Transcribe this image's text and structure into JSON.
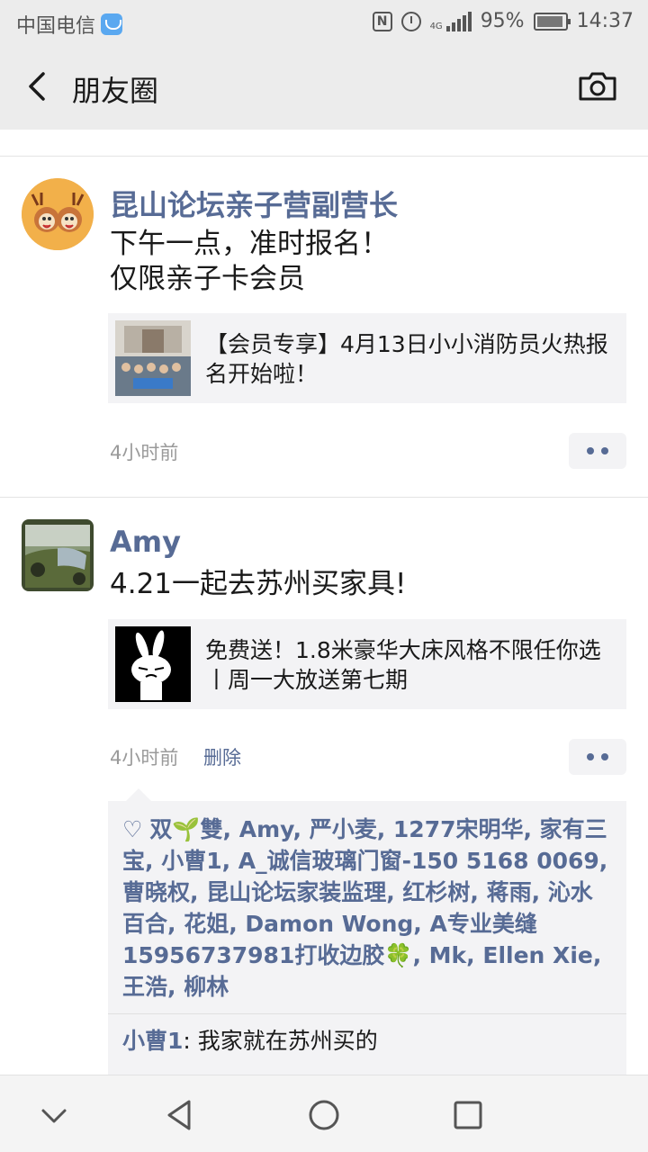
{
  "status_bar": {
    "carrier": "中国电信",
    "battery": "95%",
    "time": "14:37",
    "network": "4G"
  },
  "nav": {
    "title": "朋友圈",
    "back_icon": "chevron-left-icon",
    "camera_icon": "camera-icon"
  },
  "posts": [
    {
      "author": "昆山论坛亲子营副营长",
      "text_line1": "下午一点，准时报名！",
      "text_line2": "仅限亲子卡会员",
      "link_title": "【会员专享】4月13日小小消防员火热报名开始啦！",
      "time": "4小时前"
    },
    {
      "author": "Amy",
      "text_line1": "4.21一起去苏州买家具!",
      "link_title": "免费送！1.8米豪华大床风格不限任你选丨周一大放送第七期",
      "time": "4小时前",
      "delete_label": "删除",
      "likes": "双🌱雙, Amy, 严小麦, 1277宋明华, 家有三宝, 小曹1, A_诚信玻璃门窗-150 5168 0069, 曹晓权, 昆山论坛家装监理, 红杉树, 蒋雨, 沁水百合, 花姐, Damon Wong, A专业美缝15956737981打收边胶🍀, Mk, Ellen Xie, 王浩, 柳林",
      "comment": {
        "author": "小曹1",
        "text": ": 我家就在苏州买的"
      }
    }
  ],
  "colors": {
    "link_blue": "#576b95",
    "bar_gray": "#ececec",
    "card_bg": "#f3f3f5"
  }
}
